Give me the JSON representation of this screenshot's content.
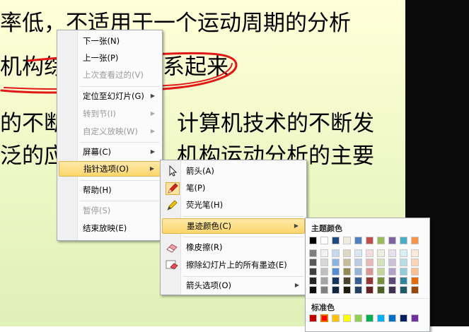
{
  "slide": {
    "lines": [
      "率低，不适用于一个运动周期的分析",
      "机构综",
      "系起来",
      "的不断",
      "计算机技术的不断发",
      "泛的应",
      "机构运动分析的主要"
    ]
  },
  "context_menu": {
    "items": [
      {
        "label": "下一张(N)",
        "disabled": false
      },
      {
        "label": "上一张(P)",
        "disabled": false
      },
      {
        "label": "上次查看过的(V)",
        "disabled": true
      },
      {
        "label": "定位至幻灯片(G)",
        "disabled": false
      },
      {
        "label": "转到节(I)",
        "disabled": true
      },
      {
        "label": "自定义放映(W)",
        "disabled": true
      },
      {
        "label": "屏幕(C)",
        "disabled": false
      },
      {
        "label": "指针选项(O)",
        "disabled": false
      },
      {
        "label": "帮助(H)",
        "disabled": false
      },
      {
        "label": "暂停(S)",
        "disabled": true
      },
      {
        "label": "结束放映(E)",
        "disabled": false
      }
    ]
  },
  "pointer_menu": {
    "items": [
      {
        "label": "箭头(A)",
        "icon": "arrow-cursor-icon"
      },
      {
        "label": "笔(P)",
        "icon": "pen-icon"
      },
      {
        "label": "荧光笔(H)",
        "icon": "highlighter-icon"
      },
      {
        "label": "墨迹颜色(C)"
      },
      {
        "label": "橡皮擦(R)",
        "icon": "eraser-icon"
      },
      {
        "label": "擦除幻灯片上的所有墨迹(E)",
        "icon": "erase-all-icon"
      },
      {
        "label": "箭头选项(O)"
      }
    ]
  },
  "color_menu": {
    "theme_title": "主题颜色",
    "standard_title": "标准色",
    "theme_top": [
      "#000000",
      "#ffffff",
      "#1f497d",
      "#eeece1",
      "#4f81bd",
      "#c0504d",
      "#9bbb59",
      "#8064a2",
      "#4bacc6",
      "#f79646"
    ],
    "theme_shades": [
      [
        "#7f7f7f",
        "#f2f2f2",
        "#c6d9f0",
        "#ddd9c3",
        "#dbe5f1",
        "#f2dcdb",
        "#ebf1dd",
        "#e5e0ec",
        "#dbeef3",
        "#fdeada"
      ],
      [
        "#595959",
        "#d8d8d8",
        "#8db3e2",
        "#c4bd97",
        "#b8cce4",
        "#e5b9b7",
        "#d7e3bc",
        "#ccc1d9",
        "#b7dde8",
        "#fbd5b5"
      ],
      [
        "#3f3f3f",
        "#bfbfbf",
        "#548dd4",
        "#938953",
        "#95b3d7",
        "#d99694",
        "#c3d69b",
        "#b2a2c7",
        "#92cddc",
        "#fac08f"
      ],
      [
        "#262626",
        "#a5a5a5",
        "#17365d",
        "#494429",
        "#366092",
        "#953734",
        "#76923c",
        "#5f497a",
        "#31859b",
        "#e36c09"
      ],
      [
        "#0c0c0c",
        "#7f7f7f",
        "#0f243e",
        "#1d1b10",
        "#244061",
        "#632423",
        "#4f6128",
        "#3f3151",
        "#205867",
        "#974806"
      ]
    ],
    "standard": [
      "#c00000",
      "#ff0000",
      "#ffc000",
      "#ffff00",
      "#92d050",
      "#00b050",
      "#00b0f0",
      "#0070c0",
      "#002060",
      "#7030a0"
    ],
    "selected_standard_index": 1
  }
}
